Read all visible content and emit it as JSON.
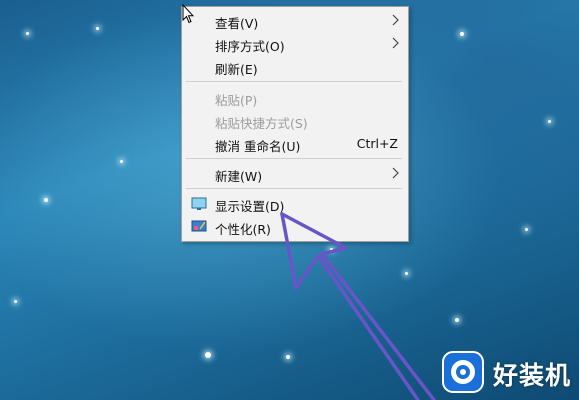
{
  "context_menu": {
    "items": [
      {
        "label": "查看(V)",
        "submenu": true,
        "disabled": false
      },
      {
        "label": "排序方式(O)",
        "submenu": true,
        "disabled": false
      },
      {
        "label": "刷新(E)",
        "submenu": false,
        "disabled": false
      },
      {
        "label": "粘贴(P)",
        "submenu": false,
        "disabled": true
      },
      {
        "label": "粘贴快捷方式(S)",
        "submenu": false,
        "disabled": true
      },
      {
        "label": "撤消 重命名(U)",
        "shortcut": "Ctrl+Z",
        "submenu": false,
        "disabled": false
      },
      {
        "label": "新建(W)",
        "submenu": true,
        "disabled": false
      },
      {
        "label": "显示设置(D)",
        "icon": "display-settings-icon",
        "submenu": false,
        "disabled": false
      },
      {
        "label": "个性化(R)",
        "icon": "personalize-icon",
        "submenu": false,
        "disabled": false
      }
    ]
  },
  "annotation": {
    "color": "#6a55c8",
    "icon": "pointer-arrow-annotation"
  },
  "watermark": {
    "text": "好装机",
    "icon": "watermark-logo-icon"
  },
  "colors": {
    "menu_bg": "#f2f2f2",
    "menu_border": "#a0a0a0",
    "disabled_text": "#9c9c9c",
    "desktop_blue": "#2a86b8"
  }
}
